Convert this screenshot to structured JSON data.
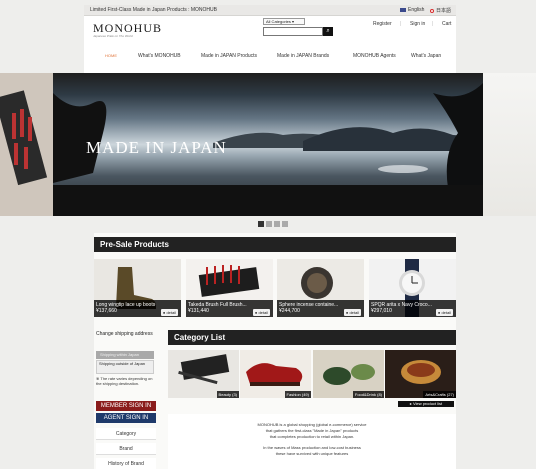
{
  "topbar": {
    "text": "Limited First-Class Made in Japan Products : MONOHUB",
    "lang_en": "English",
    "lang_ja": "日本語",
    "flag_colors": {
      "en": "#3b4a8c",
      "ja": "#d62b2b"
    }
  },
  "header": {
    "logo": "MONOHUB",
    "tagline": "Japanese Pride on The World",
    "category_select": "All Categories",
    "search_placeholder": "",
    "links": [
      "Register",
      "Sign in",
      "Cart"
    ]
  },
  "nav": {
    "items": [
      "HOME",
      "What's MONOHUB",
      "Made in JAPAN Products",
      "Made in JAPAN Brands",
      "MONOHUB Agents",
      "What's Japan"
    ],
    "active_color": "#e0743a"
  },
  "hero": {
    "title": "MADE IN JAPAN"
  },
  "presale": {
    "title": "Pre-Sale Products",
    "detail_label": "detail",
    "products": [
      {
        "name": "Long wingtip lace up boots",
        "price": "¥137,660"
      },
      {
        "name": "Takeda Brush Full Brush...",
        "price": "¥131,440"
      },
      {
        "name": "Sphere incense containe...",
        "price": "¥244,700"
      },
      {
        "name": "SPQR arita x Navy Croco...",
        "price": "¥297,010"
      }
    ]
  },
  "sidebar": {
    "title": "Change shipping address",
    "option1": "Shipping within Japan",
    "option2": "Shipping outside of Japan",
    "note": "※ The rate varies depending on the shipping destination.",
    "member_signin": "MEMBER SIGN IN",
    "agent_signin": "AGENT SIGN IN",
    "links": [
      "Category",
      "Brand",
      "History of Brand"
    ],
    "colors": {
      "member": "#8a1c1c",
      "agent": "#1f3a6b"
    }
  },
  "category": {
    "title": "Category List",
    "items": [
      "Beauty (3)",
      "Fashion (49)",
      "Food&Drink (8)",
      "Arts&Crafts (27)"
    ],
    "view_product_list": "▸ View product list"
  },
  "about": {
    "lines": [
      "MONOHUB is a global shopping (global e-commerce) service",
      "that gathers the first-class \"Made in Japan\" products",
      "that completes production to retail within Japan.",
      "",
      "In the waves of Mass production and low-cost business",
      "these have survived with unique features"
    ]
  }
}
